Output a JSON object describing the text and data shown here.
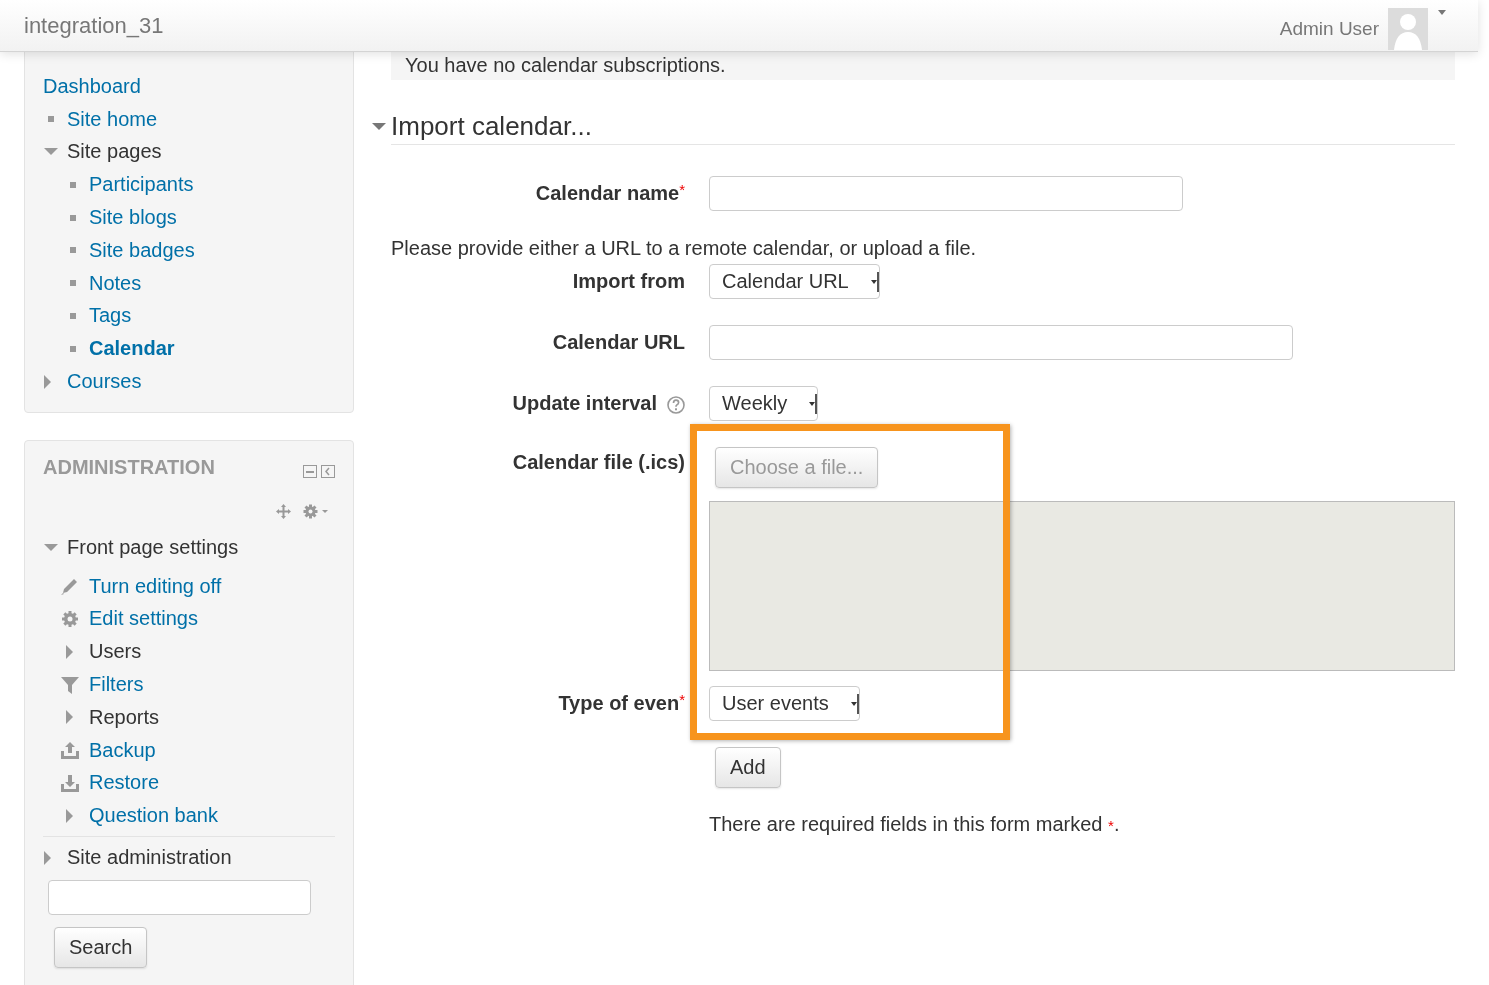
{
  "navbar": {
    "site_name": "integration_31",
    "user_name": "Admin User"
  },
  "navigation": {
    "items": [
      {
        "label": "Dashboard",
        "kind": "root",
        "link": true,
        "current": false
      },
      {
        "label": "Site home",
        "kind": "leaf",
        "link": true,
        "current": false
      },
      {
        "label": "Site pages",
        "kind": "branch",
        "link": false,
        "current": false,
        "expanded": true,
        "children": [
          {
            "label": "Participants",
            "kind": "leaf",
            "link": true,
            "current": false
          },
          {
            "label": "Site blogs",
            "kind": "leaf",
            "link": true,
            "current": false
          },
          {
            "label": "Site badges",
            "kind": "leaf",
            "link": true,
            "current": false
          },
          {
            "label": "Notes",
            "kind": "leaf",
            "link": true,
            "current": false
          },
          {
            "label": "Tags",
            "kind": "leaf",
            "link": true,
            "current": false
          },
          {
            "label": "Calendar",
            "kind": "leaf",
            "link": true,
            "current": true
          }
        ]
      },
      {
        "label": "Courses",
        "kind": "branch",
        "link": true,
        "current": false,
        "expanded": false
      }
    ]
  },
  "administration": {
    "title": "ADMINISTRATION",
    "items": [
      {
        "label": "Front page settings",
        "kind": "branch",
        "link": false,
        "current": false,
        "expanded": true,
        "children": [
          {
            "label": "Turn editing off",
            "kind": "edit",
            "link": true,
            "current": false
          },
          {
            "label": "Edit settings",
            "kind": "settings",
            "link": true,
            "current": false
          },
          {
            "label": "Users",
            "kind": "branch",
            "link": false,
            "current": false,
            "expanded": false
          },
          {
            "label": "Filters",
            "kind": "filter",
            "link": true,
            "current": false
          },
          {
            "label": "Reports",
            "kind": "branch",
            "link": false,
            "current": false,
            "expanded": false
          },
          {
            "label": "Backup",
            "kind": "backup",
            "link": true,
            "current": false
          },
          {
            "label": "Restore",
            "kind": "restore",
            "link": true,
            "current": false
          },
          {
            "label": "Question bank",
            "kind": "branch",
            "link": true,
            "current": false,
            "expanded": false
          }
        ]
      }
    ],
    "footer_items": [
      {
        "label": "Site administration",
        "kind": "branch",
        "link": false,
        "current": false,
        "expanded": false
      }
    ],
    "search_button": "Search"
  },
  "subscriptions_message": "You have no calendar subscriptions.",
  "section": {
    "title": "Import calendar...",
    "expanded": true
  },
  "form": {
    "required_mark": "*",
    "fields": [
      {
        "kind": "text",
        "label": "Calendar name",
        "required": true,
        "help": false
      },
      {
        "kind": "note",
        "text": "Please provide either a URL to a remote calendar, or upload a file."
      },
      {
        "kind": "select",
        "label": "Import from",
        "required": false,
        "help": false,
        "value": "Calendar URL"
      },
      {
        "kind": "url",
        "label": "Calendar URL",
        "required": false,
        "help": false
      },
      {
        "kind": "select",
        "label": "Update interval",
        "required": false,
        "help": true,
        "value": "Weekly"
      },
      {
        "kind": "file",
        "label": "Calendar file (.ics)",
        "required": false,
        "help": false,
        "button": "Choose a file..."
      },
      {
        "kind": "select",
        "label": "Type of even",
        "required": true,
        "help": false,
        "value": "User events"
      }
    ],
    "submit": "Add",
    "required_note": {
      "text": "There are required fields in this form marked",
      "end": "."
    }
  },
  "annotations": [
    {
      "kind": "rectangle"
    }
  ]
}
